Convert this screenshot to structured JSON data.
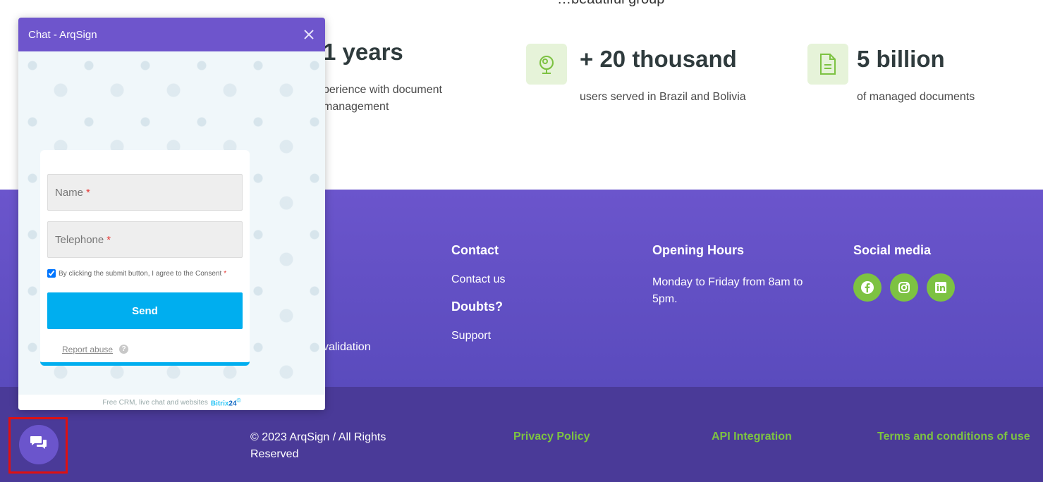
{
  "stats": {
    "cut_heading": "…beautiful group",
    "items": [
      {
        "title": "1 years",
        "desc": "perience with document management",
        "icon": "document-experience-icon"
      },
      {
        "title": "+ 20 thousand",
        "desc": "users served in Brazil and Bolivia",
        "icon": "globe-icon"
      },
      {
        "title": "5 billion",
        "desc": "of managed documents",
        "icon": "document-icon"
      }
    ]
  },
  "footer": {
    "validation_text": "validation",
    "contact": {
      "heading": "Contact",
      "link": "Contact us"
    },
    "doubts": {
      "heading": "Doubts?",
      "link": "Support"
    },
    "hours": {
      "heading": "Opening Hours",
      "text": "Monday to Friday from 8am to 5pm."
    },
    "social": {
      "heading": "Social media",
      "icons": [
        "facebook-icon",
        "instagram-icon",
        "linkedin-icon"
      ]
    }
  },
  "bottom": {
    "copyright": "© 2023 ArqSign / All Rights Reserved",
    "links": [
      "Privacy Policy",
      "API Integration",
      "Terms and conditions of use"
    ]
  },
  "chat": {
    "title": "Chat - ArqSign",
    "name_placeholder": "Name",
    "phone_placeholder": "Telephone",
    "required_mark": "*",
    "consent_text": "By clicking the submit button, I agree to the Consent",
    "consent_checked": true,
    "send_label": "Send",
    "report_label": "Report abuse",
    "help_glyph": "?",
    "footer_text": "Free CRM, live chat and websites",
    "footer_brand": "Bitrix",
    "footer_brand_num": "24",
    "footer_brand_mark": "©"
  },
  "colors": {
    "accent_purple": "#6b55cc",
    "green": "#7dc242",
    "send_blue": "#00aeef"
  }
}
